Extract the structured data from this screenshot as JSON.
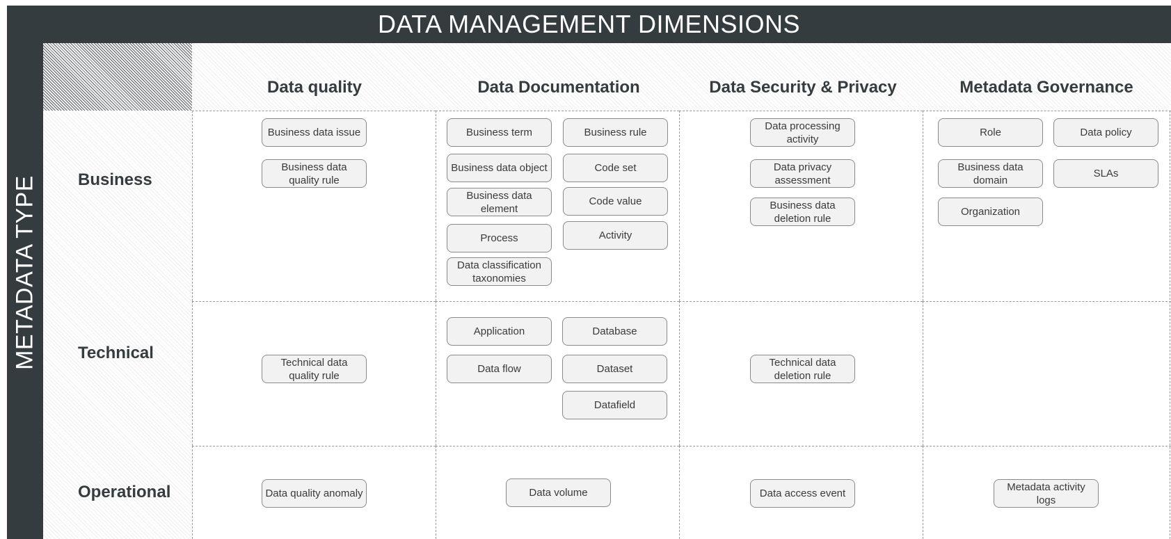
{
  "title": "DATA MANAGEMENT DIMENSIONS",
  "vertical_title": "METADATA TYPE",
  "columns": [
    "Data quality",
    "Data Documentation",
    "Data Security & Privacy",
    "Metadata Governance"
  ],
  "rows": [
    "Business",
    "Technical",
    "Operational"
  ],
  "items": {
    "business_issue": "Business data issue",
    "business_dq_rule": "Business data quality rule",
    "business_term": "Business term",
    "business_rule": "Business rule",
    "business_data_object": "Business data object",
    "code_set": "Code set",
    "business_data_element": "Business data element",
    "code_value": "Code value",
    "process": "Process",
    "activity": "Activity",
    "data_classification": "Data classification taxonomies",
    "data_processing_activity": "Data processing activity",
    "data_privacy_assessment": "Data privacy assessment",
    "business_deletion_rule": "Business data deletion rule",
    "role": "Role",
    "data_policy": "Data policy",
    "business_data_domain": "Business data domain",
    "slas": "SLAs",
    "organization": "Organization",
    "technical_dq_rule": "Technical data quality rule",
    "application": "Application",
    "database": "Database",
    "data_flow": "Data flow",
    "dataset": "Dataset",
    "datafield": "Datafield",
    "technical_deletion_rule": "Technical data deletion rule",
    "dq_anomaly": "Data quality anomaly",
    "data_volume": "Data volume",
    "data_access_event": "Data access event",
    "metadata_activity_logs": "Metadata activity logs"
  }
}
